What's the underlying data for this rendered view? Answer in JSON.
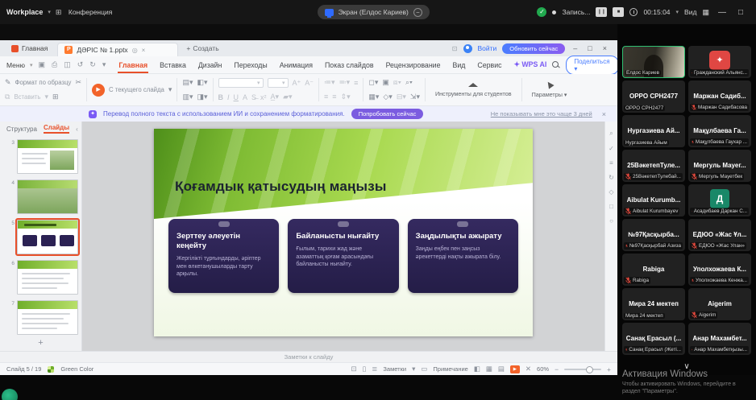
{
  "conference": {
    "workspace_label": "Workplace",
    "menu_conference": "Конференция",
    "screen_tab": "Экран (Елдос Кариев)",
    "recording_label": "Запись...",
    "timer": "00:15:04",
    "view_label": "Вид"
  },
  "wps": {
    "home_tab": "Главная",
    "doc_tab": "ДӘРІС № 1.pptx",
    "new_tab": "Создать",
    "login": "Войти",
    "upgrade": "Обновить сейчас",
    "menu": "Меню",
    "ribbon_tabs": [
      {
        "label": "Главная",
        "state": "active"
      },
      {
        "label": "Вставка",
        "state": ""
      },
      {
        "label": "Дизайн",
        "state": ""
      },
      {
        "label": "Переходы",
        "state": ""
      },
      {
        "label": "Анимация",
        "state": ""
      },
      {
        "label": "Показ слайдов",
        "state": ""
      },
      {
        "label": "Рецензирование",
        "state": ""
      },
      {
        "label": "Вид",
        "state": ""
      },
      {
        "label": "Сервис",
        "state": ""
      },
      {
        "label": "WPS AI",
        "state": "ai"
      }
    ],
    "share": "Поделиться",
    "toolbar": {
      "format_painter": "Формат по образцу",
      "paste": "Вставить",
      "from_current": "С текущего слайда",
      "student_tools": "Инструменты для студентов",
      "options": "Параметры"
    },
    "banner": {
      "text": "Перевод полного текста с использованием ИИ и сохранением форматирования.",
      "button": "Попробовать сейчас",
      "dismiss": "Не показывать мне это чаще 3 дней"
    },
    "panel": {
      "tab_structure": "Структура",
      "tab_slides": "Слайды"
    },
    "thumbnails": [
      {
        "num": "3",
        "kind": "photo",
        "selected": false
      },
      {
        "num": "4",
        "kind": "photo-full",
        "selected": false
      },
      {
        "num": "5",
        "kind": "cards",
        "selected": true
      },
      {
        "num": "6",
        "kind": "text",
        "selected": false
      },
      {
        "num": "7",
        "kind": "text",
        "selected": false
      }
    ],
    "notes_hint": "Заметки к слайду",
    "status": {
      "slide_indicator": "Слайд 5 / 19",
      "theme": "Green Color",
      "notes": "Заметки",
      "comment": "Примечание",
      "zoom": "60%"
    }
  },
  "slide": {
    "title": "Қоғамдық қатысудың маңызы",
    "cards": [
      {
        "title": "Зерттеу әлеуетін кеңейту",
        "body": "Жергілікті тұрғындарды, әріптер мен өлкетанушыларды тарту арқылы."
      },
      {
        "title": "Байланысты нығайту",
        "body": "Ғылым, тарихи жад және азаматтық қоғам арасындағы байланысты нығайту."
      },
      {
        "title": "Заңдылықты ажырату",
        "body": "Заңды еңбек пен заңсыз әрекеттерді нақты ажырата білу."
      }
    ]
  },
  "participants": [
    {
      "type": "video",
      "name": "",
      "label": "Елдос Кариев",
      "muted": false
    },
    {
      "type": "logo",
      "name": "",
      "label": "Гражданский Альянс...",
      "muted": true
    },
    {
      "type": "name",
      "name": "OPPO CPH2477",
      "label": "OPPO CPH2477",
      "muted": false
    },
    {
      "type": "name",
      "name": "Маржан Садиб...",
      "label": "Маржан Садибасова",
      "muted": true
    },
    {
      "type": "name",
      "name": "Нургазиева Ай...",
      "label": "Нургазиева Айым",
      "muted": false
    },
    {
      "type": "name",
      "name": "Мақұлбаева Га...",
      "label": "Мақұлбаева Гаухар ...",
      "muted": true
    },
    {
      "type": "name",
      "name": "25ВәкетепТуле...",
      "label": "25ВәкетепТулебай...",
      "muted": true
    },
    {
      "type": "name",
      "name": "Мергуль Мауег...",
      "label": "Мергуль Мауетбек",
      "muted": true
    },
    {
      "type": "name",
      "name": "Aibulat Kurumb...",
      "label": "Aibulat Kurumbayev",
      "muted": true
    },
    {
      "type": "avatar",
      "name": "Д",
      "label": "Асадибаев Даркан С...",
      "muted": true
    },
    {
      "type": "name",
      "name": "№97Қасқырба...",
      "label": "№97Қасқырбай Азиза",
      "muted": true
    },
    {
      "type": "name",
      "name": "ЕДЮО «Жас Ұл...",
      "label": "ЕДЮО «Жас Улан»",
      "muted": true
    },
    {
      "type": "name",
      "name": "Rabiga",
      "label": "Rabiga",
      "muted": true
    },
    {
      "type": "name",
      "name": "Уполхожаева К...",
      "label": "Уполхожаева Кенжа...",
      "muted": true
    },
    {
      "type": "name",
      "name": "Мира 24 мектеп",
      "label": "Мира 24 мектеп",
      "muted": false
    },
    {
      "type": "name",
      "name": "Aigerim",
      "label": "Aigerim",
      "muted": true
    },
    {
      "type": "name",
      "name": "Санақ Ерасыл (...",
      "label": "Санақ Ерасыл (Жеті...",
      "muted": true
    },
    {
      "type": "name",
      "name": "Анар Махамбет...",
      "label": "Анар Махамбетқызы...",
      "muted": true
    }
  ],
  "watermark": {
    "line1": "Активация Windows",
    "line2": "Чтобы активировать Windows, перейдите в раздел \"Параметры\"."
  },
  "colors": {
    "accent_orange": "#e8502a",
    "accent_purple": "#7a5af5",
    "accent_blue": "#2f6bff",
    "slide_green": "#8dc63f",
    "card_purple": "#2b2153",
    "muted_red": "#e0483c",
    "speaking_green": "#2fbf71"
  }
}
